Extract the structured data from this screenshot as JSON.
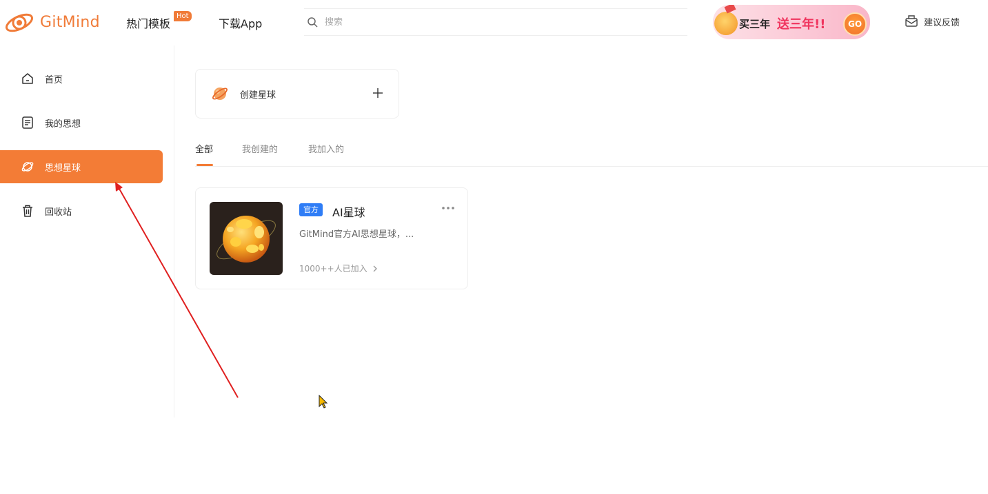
{
  "brand": {
    "name": "GitMind",
    "accent": "#f37c36"
  },
  "header": {
    "nav": [
      {
        "label": "热门模板",
        "badge": "Hot"
      },
      {
        "label": "下载App"
      }
    ],
    "search": {
      "placeholder": "搜索",
      "value": ""
    },
    "promo": {
      "buy_text": "买三年",
      "give_text": "送三年!!",
      "go_label": "GO"
    },
    "feedback_label": "建议反馈"
  },
  "sidebar": {
    "items": [
      {
        "label": "首页",
        "icon": "home-icon",
        "active": false
      },
      {
        "label": "我的思想",
        "icon": "document-icon",
        "active": false
      },
      {
        "label": "思想星球",
        "icon": "planet-icon",
        "active": true
      },
      {
        "label": "回收站",
        "icon": "trash-icon",
        "active": false
      }
    ]
  },
  "main": {
    "create_planet_label": "创建星球",
    "tabs": [
      {
        "label": "全部",
        "active": true
      },
      {
        "label": "我创建的",
        "active": false
      },
      {
        "label": "我加入的",
        "active": false
      }
    ],
    "planets": [
      {
        "badge": "官方",
        "name": "AI星球",
        "description": "GitMind官方AI思想星球，...",
        "members": "1000++人已加入"
      }
    ]
  },
  "colors": {
    "official_badge": "#2f7df6",
    "annotation_arrow": "#e02020"
  }
}
